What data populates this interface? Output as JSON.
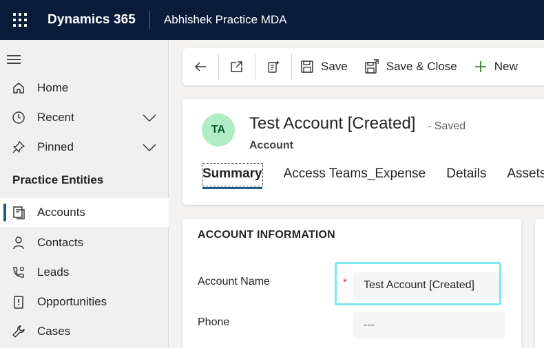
{
  "topbar": {
    "brand": "Dynamics 365",
    "app_name": "Abhishek Practice MDA"
  },
  "sidebar": {
    "items_top": [
      {
        "label": "Home",
        "icon": "home-icon"
      },
      {
        "label": "Recent",
        "icon": "clock-icon"
      },
      {
        "label": "Pinned",
        "icon": "pin-icon"
      }
    ],
    "group_title": "Practice Entities",
    "entities": [
      {
        "label": "Accounts",
        "icon": "accounts-icon",
        "active": true
      },
      {
        "label": "Contacts",
        "icon": "person-icon"
      },
      {
        "label": "Leads",
        "icon": "leads-icon"
      },
      {
        "label": "Opportunities",
        "icon": "opportunity-icon"
      },
      {
        "label": "Cases",
        "icon": "wrench-icon"
      }
    ]
  },
  "commandbar": {
    "save": "Save",
    "save_close": "Save & Close",
    "new": "New"
  },
  "record": {
    "avatar_initials": "TA",
    "title": "Test Account [Created]",
    "status": "- Saved",
    "entity": "Account",
    "tabs": [
      "Summary",
      "Access Teams_Expense",
      "Details",
      "Assets an"
    ]
  },
  "section": {
    "title": "ACCOUNT INFORMATION",
    "fields": [
      {
        "label": "Account Name",
        "value": "Test Account [Created]",
        "required": "*"
      },
      {
        "label": "Phone",
        "value": "---"
      }
    ]
  },
  "colors": {
    "topbar": "#0b1c3a",
    "accent": "#1b5a8a",
    "highlight": "#7ee8f0",
    "avatar_bg": "#b2ecc5"
  }
}
